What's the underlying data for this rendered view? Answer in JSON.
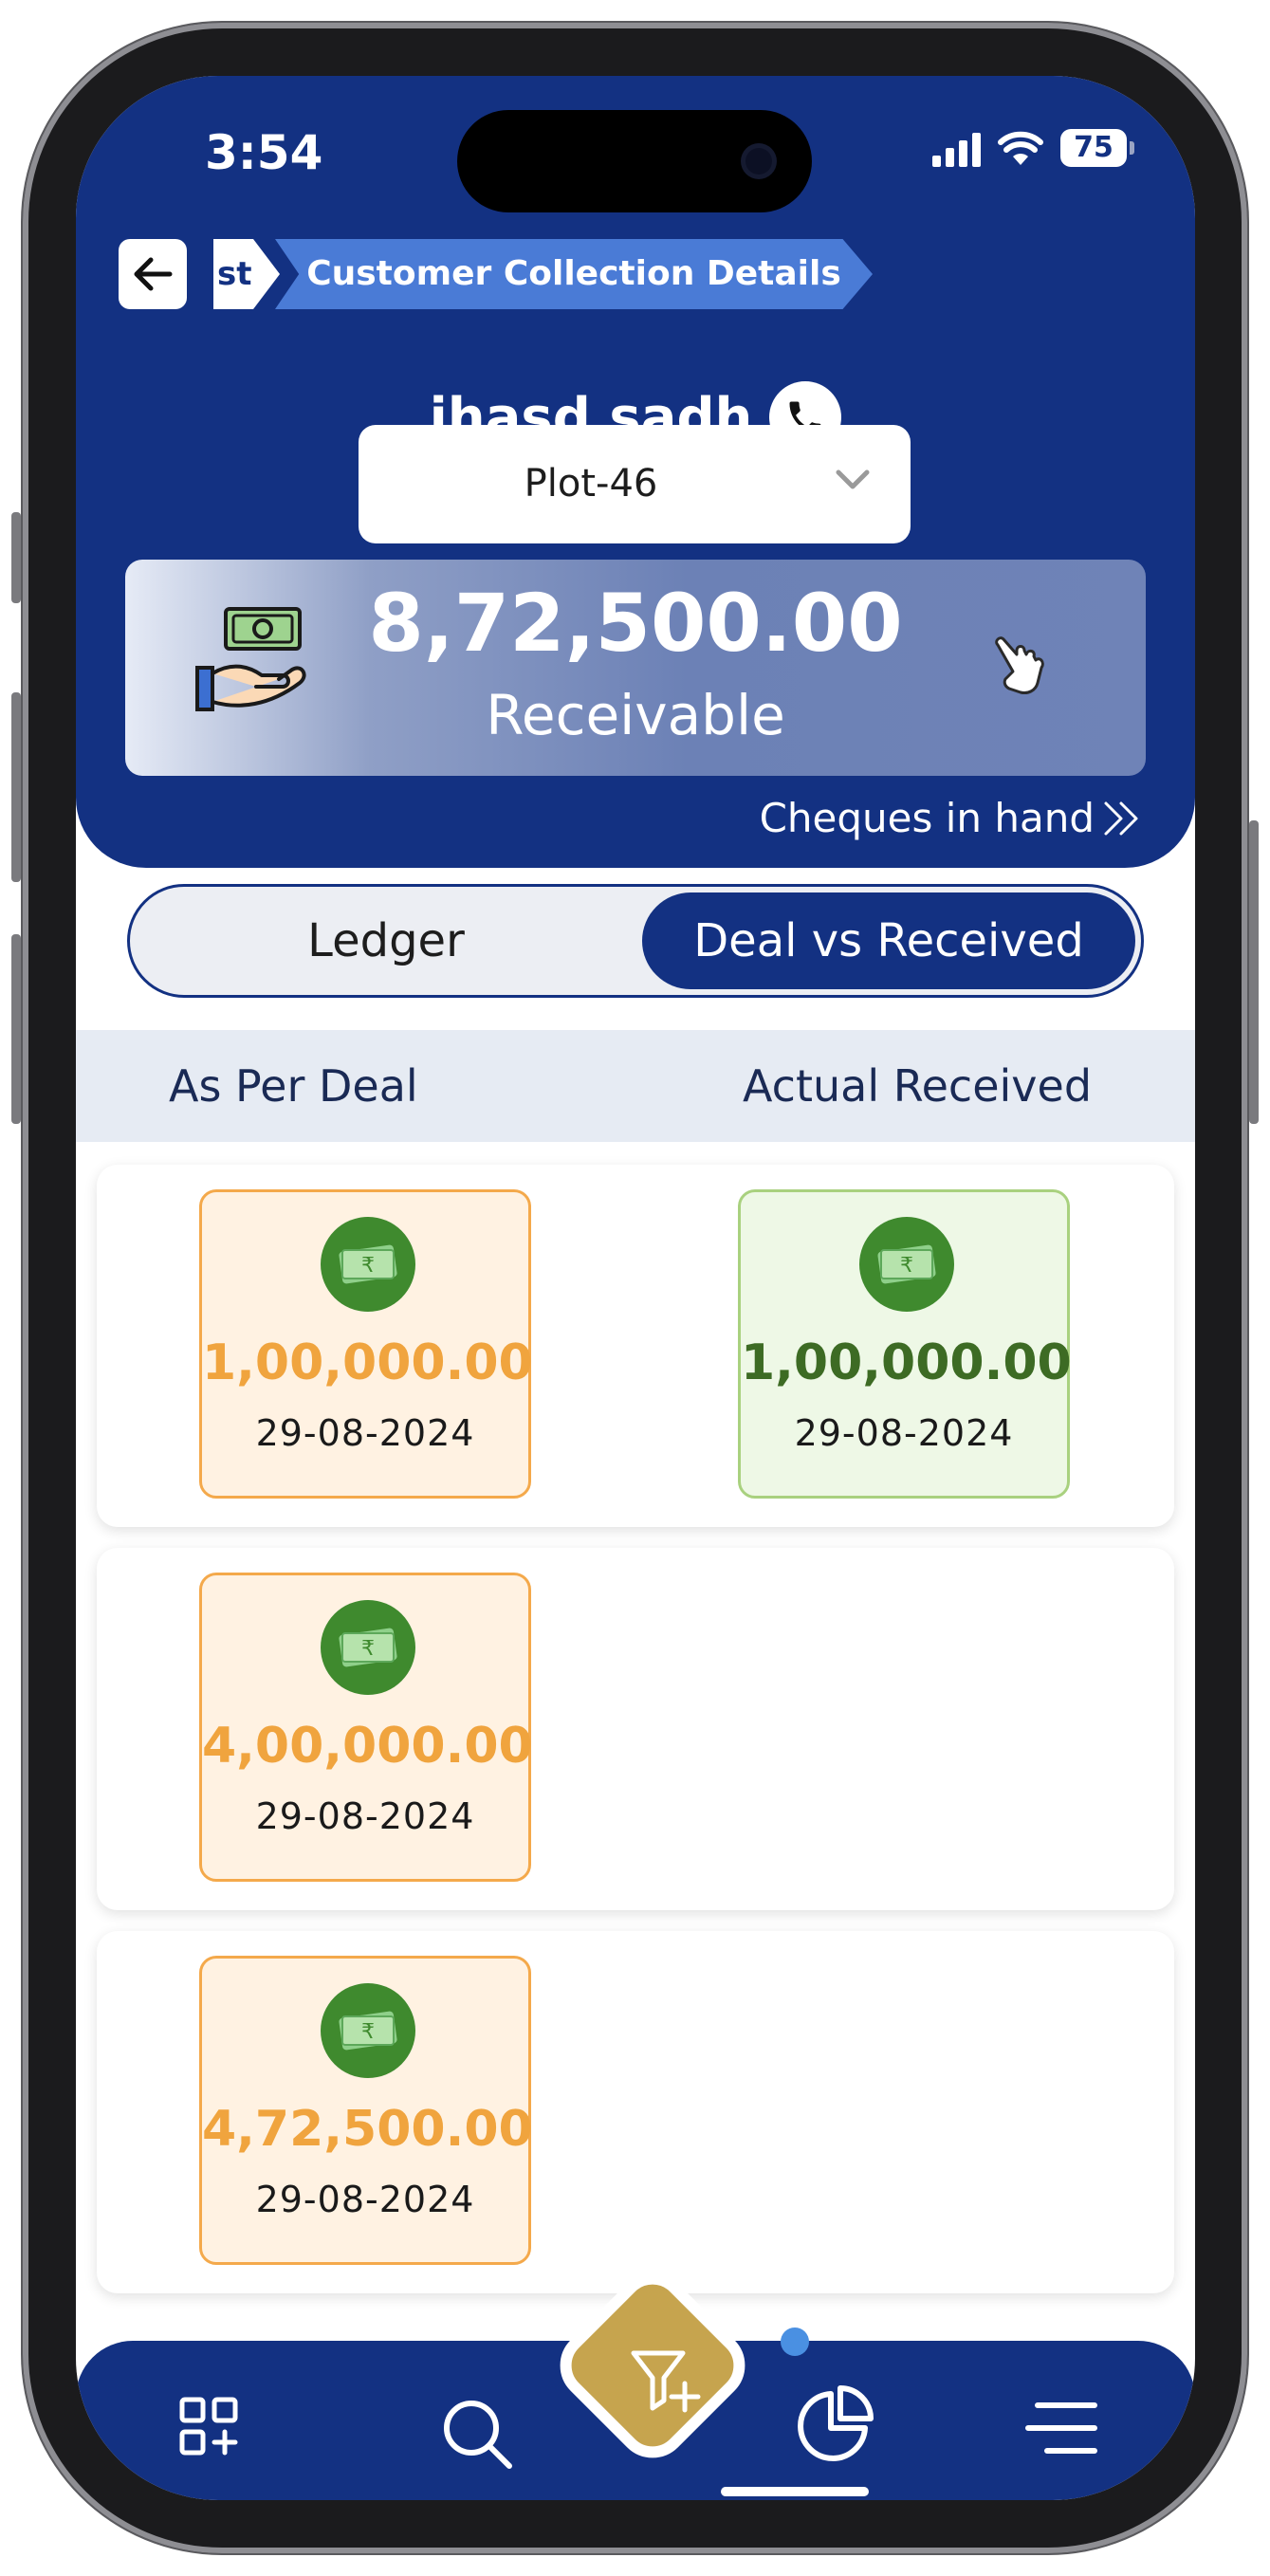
{
  "status_bar": {
    "time": "3:54",
    "battery": "75"
  },
  "breadcrumb": {
    "previous": "st",
    "current": "Customer Collection Details"
  },
  "customer": {
    "name": "jhasd sadh"
  },
  "plot_select": {
    "value": "Plot-46"
  },
  "receivable": {
    "amount": "8,72,500.00",
    "label": "Receivable"
  },
  "cheques_link": {
    "label": "Cheques in hand"
  },
  "tabs": {
    "ledger": "Ledger",
    "deal_vs_received": "Deal vs Received",
    "active": "deal_vs_received"
  },
  "columns": {
    "deal": "As Per Deal",
    "received": "Actual Received"
  },
  "rows": [
    {
      "deal": {
        "amount": "1,00,000.00",
        "date": "29-08-2024"
      },
      "received": {
        "amount": "1,00,000.00",
        "date": "29-08-2024"
      }
    },
    {
      "deal": {
        "amount": "4,00,000.00",
        "date": "29-08-2024"
      }
    },
    {
      "deal": {
        "amount": "4,72,500.00",
        "date": "29-08-2024"
      }
    }
  ],
  "colors": {
    "primary": "#133182",
    "deal_accent": "#f0a43e",
    "received_accent": "#3d6b24",
    "fab": "#c6a44e"
  },
  "bottom_nav": [
    "dashboard-add-icon",
    "search-icon",
    "filter-add-icon",
    "pie-chart-icon",
    "menu-icon"
  ]
}
